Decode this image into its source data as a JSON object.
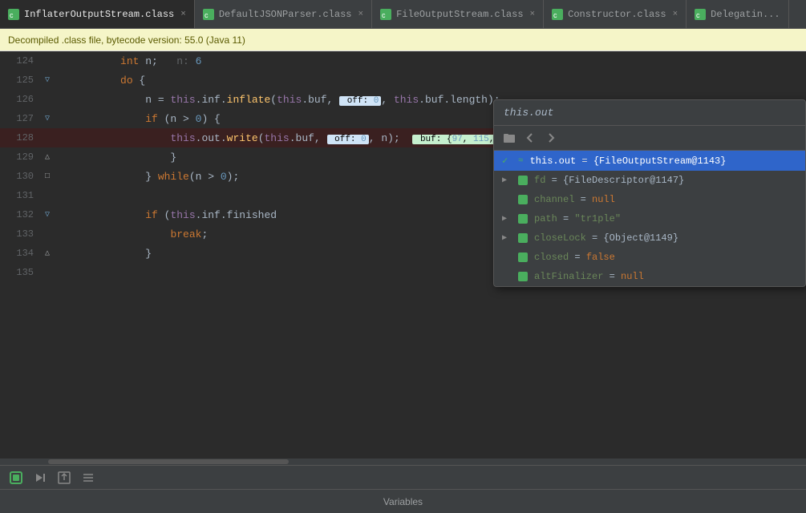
{
  "tabs": [
    {
      "label": "InflaterOutputStream.class",
      "active": true,
      "icon_color": "#4aae5e",
      "closable": true
    },
    {
      "label": "DefaultJSONParser.class",
      "active": false,
      "icon_color": "#4aae5e",
      "closable": true
    },
    {
      "label": "FileOutputStream.class",
      "active": false,
      "icon_color": "#4aae5e",
      "closable": true
    },
    {
      "label": "Constructor.class",
      "active": false,
      "icon_color": "#4aae5e",
      "closable": true
    },
    {
      "label": "Delegatin...",
      "active": false,
      "icon_color": "#4aae5e",
      "closable": false
    }
  ],
  "warning_bar": "Decompiled .class file, bytecode version: 55.0 (Java 11)",
  "lines": [
    {
      "num": "124",
      "gutter": "",
      "content": "    int n;   n: 6",
      "highlighted": false
    },
    {
      "num": "125",
      "gutter": "▽",
      "content": "    do {",
      "highlighted": false
    },
    {
      "num": "126",
      "gutter": "",
      "content": "        n = this.inf.inflate(this.buf,  off: 0,  this.buf.length);",
      "highlighted": false
    },
    {
      "num": "127",
      "gutter": "▽",
      "content": "        if (n > 0) {",
      "highlighted": false
    },
    {
      "num": "128",
      "gutter": "",
      "content": "            this.out.write(this.buf,  off: 0, n);   buf: {97, 115,",
      "highlighted": true
    },
    {
      "num": "129",
      "gutter": "△",
      "content": "        }",
      "highlighted": false
    },
    {
      "num": "130",
      "gutter": "□",
      "content": "    } while(n > 0);",
      "highlighted": false
    },
    {
      "num": "131",
      "gutter": "",
      "content": "",
      "highlighted": false
    },
    {
      "num": "132",
      "gutter": "▽",
      "content": "    if (this.inf.finished",
      "highlighted": false
    },
    {
      "num": "133",
      "gutter": "",
      "content": "        break;",
      "highlighted": false
    },
    {
      "num": "134",
      "gutter": "△",
      "content": "    }",
      "highlighted": false
    },
    {
      "num": "135",
      "gutter": "",
      "content": "",
      "highlighted": false
    }
  ],
  "popup": {
    "header": "this.out",
    "toolbar_buttons": [
      "folder-icon",
      "arrow-left-icon",
      "arrow-right-icon"
    ],
    "items": [
      {
        "selected": true,
        "expanded": true,
        "has_expand": false,
        "check": true,
        "double_dot": true,
        "name": "this.out",
        "eq": "=",
        "value": "{FileOutputStream@1143}",
        "field_color": "white"
      },
      {
        "selected": false,
        "expanded": false,
        "has_expand": true,
        "name": "fd",
        "eq": "=",
        "value": "{FileDescriptor@1147}",
        "field_color": "green"
      },
      {
        "selected": false,
        "expanded": false,
        "has_expand": false,
        "name": "channel",
        "eq": "=",
        "value": "null",
        "field_color": "green",
        "val_type": "null"
      },
      {
        "selected": false,
        "expanded": false,
        "has_expand": true,
        "name": "path",
        "eq": "=",
        "value": "\"tr1ple\"",
        "field_color": "green",
        "val_type": "string"
      },
      {
        "selected": false,
        "expanded": false,
        "has_expand": true,
        "name": "closeLock",
        "eq": "=",
        "value": "{Object@1149}",
        "field_color": "green"
      },
      {
        "selected": false,
        "expanded": false,
        "has_expand": false,
        "name": "closed",
        "eq": "=",
        "value": "false",
        "field_color": "green",
        "val_type": "false"
      },
      {
        "selected": false,
        "expanded": false,
        "has_expand": false,
        "name": "altFinalizer",
        "eq": "=",
        "value": "null",
        "field_color": "green",
        "val_type": "null"
      }
    ]
  },
  "bottom_buttons": [
    "record-icon",
    "skip-forward-icon",
    "export-icon",
    "list-icon"
  ],
  "variables_label": "Variables"
}
